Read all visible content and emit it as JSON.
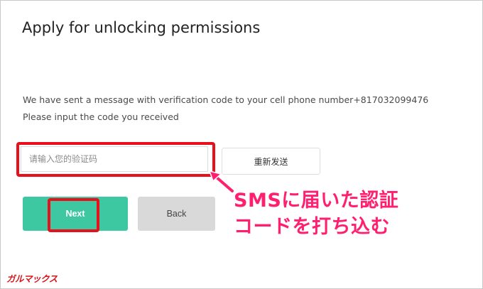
{
  "page": {
    "title": "Apply for unlocking permissions",
    "message_line1": "We have sent a message with verification code to your cell phone number+817032099476",
    "message_line2": "Please input the code you received"
  },
  "form": {
    "code_input": {
      "value": "",
      "placeholder": "请输入您的验证码"
    },
    "resend_label": "重新发送",
    "next_label": "Next",
    "back_label": "Back"
  },
  "annotation": {
    "callout_line1": "SMSに届いた認証",
    "callout_line2": "コードを打ち込む",
    "highlight_color": "#e8101a",
    "callout_color": "#ff1f6e"
  },
  "watermark": "ガルマックス",
  "colors": {
    "primary": "#3dc8a1",
    "secondary_button": "#d9d9d9"
  }
}
